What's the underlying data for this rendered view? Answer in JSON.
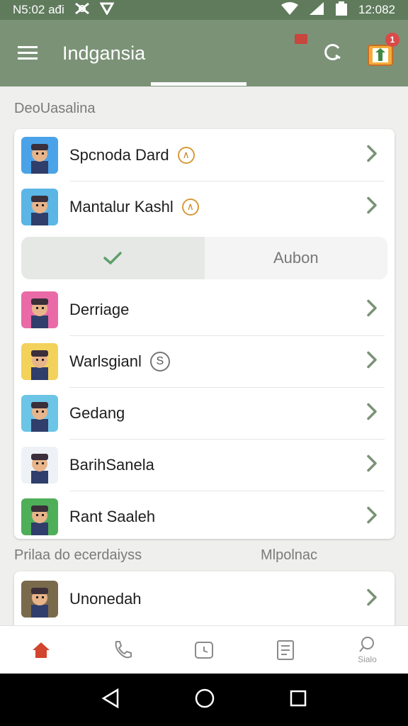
{
  "status_bar": {
    "left_text": "N5:02 ađi",
    "time": "12:082"
  },
  "app_bar": {
    "title": "Indgansia",
    "badge_count": "1"
  },
  "sections": {
    "first_title": "DeoUasalina",
    "second_title": "Prilaa do ecerdaiyss",
    "second_right": "Mlpolnac"
  },
  "list_top": [
    {
      "name": "Spcnoda Dard",
      "tag": "∧",
      "tag_style": "gold",
      "avatar_bg": "#4aa3e8"
    },
    {
      "name": "Mantalur Kashl",
      "tag": "∧",
      "tag_style": "gold",
      "avatar_bg": "#5bb6e6"
    }
  ],
  "segment": {
    "right_label": "Aubon"
  },
  "list_bottom": [
    {
      "name": "Derriage",
      "avatar_bg": "#e96aa7"
    },
    {
      "name": "Warlsgianl",
      "tag": "S",
      "tag_style": "grey",
      "avatar_bg": "#f2d25a"
    },
    {
      "name": "Gedang",
      "avatar_bg": "#6cc5e6"
    },
    {
      "name": "BarihSanela",
      "avatar_bg": "#eef2f6"
    },
    {
      "name": "Rant Saaleh",
      "avatar_bg": "#4fae58"
    }
  ],
  "list_second": [
    {
      "name": "Unonedah",
      "avatar_bg": "#7a6a4c"
    }
  ],
  "bottom_nav": {
    "search_label": "Sialo"
  },
  "colors": {
    "accent_green": "#7b9277",
    "home_red": "#d2452f",
    "chevron": "#7b9277"
  }
}
